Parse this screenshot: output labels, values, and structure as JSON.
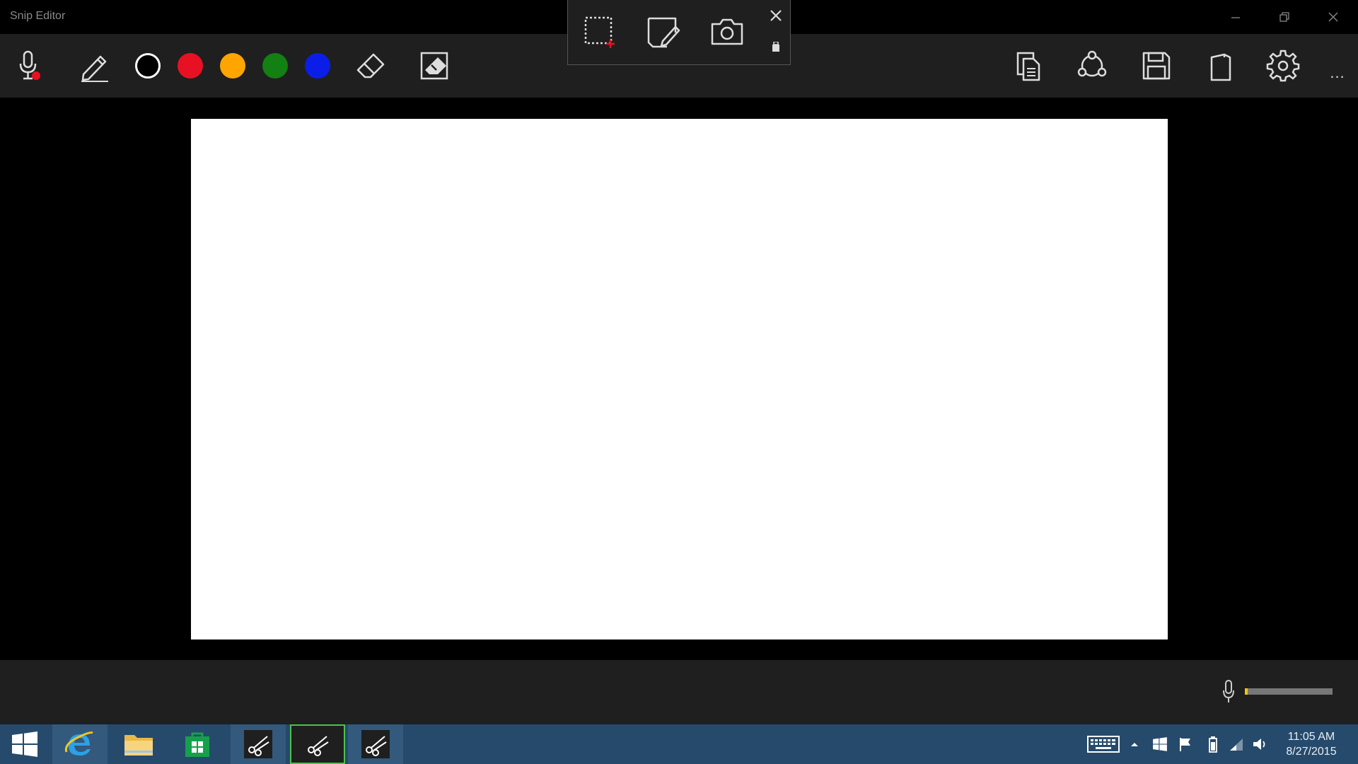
{
  "window": {
    "title": "Snip Editor",
    "controls": [
      "minimize-icon",
      "restore-icon",
      "close-icon"
    ]
  },
  "toolbar": {
    "left_tools": [
      "microphone-record-icon",
      "pen-icon"
    ],
    "colors": [
      {
        "name": "black",
        "hex": "#000000"
      },
      {
        "name": "red",
        "hex": "#e81123"
      },
      {
        "name": "orange",
        "hex": "#ffa500"
      },
      {
        "name": "green",
        "hex": "#128012"
      },
      {
        "name": "blue",
        "hex": "#0a1ee8"
      }
    ],
    "edit_tools": [
      "eraser-icon",
      "clear-all-icon"
    ],
    "right_tools": [
      "copy-icon",
      "share-icon",
      "save-icon",
      "send-to-onenote-icon",
      "settings-icon"
    ],
    "more_label": "..."
  },
  "snip_popup": {
    "actions": [
      "new-snip-icon",
      "whiteboard-icon",
      "camera-icon"
    ],
    "close": "close-icon",
    "pin": "pin-icon"
  },
  "canvas": {
    "background": "#ffffff"
  },
  "audio": {
    "mic": "microphone-icon",
    "level": 0.03
  },
  "taskbar": {
    "apps": [
      "windows-start-icon",
      "internet-explorer-icon",
      "file-explorer-icon",
      "store-icon",
      "snip-icon",
      "snip-icon",
      "snip-icon"
    ],
    "tray": [
      "touch-keyboard-icon",
      "show-hidden-icons-icon",
      "windows-logo-icon",
      "action-center-flag-icon",
      "battery-icon",
      "network-icon",
      "volume-icon"
    ],
    "time": "11:05 AM",
    "date": "8/27/2015"
  },
  "colors": {
    "titlebar": "#000000",
    "toolbar": "#1f1f1f",
    "taskbar": "#264a6b",
    "accent_level": "#f0c419"
  }
}
